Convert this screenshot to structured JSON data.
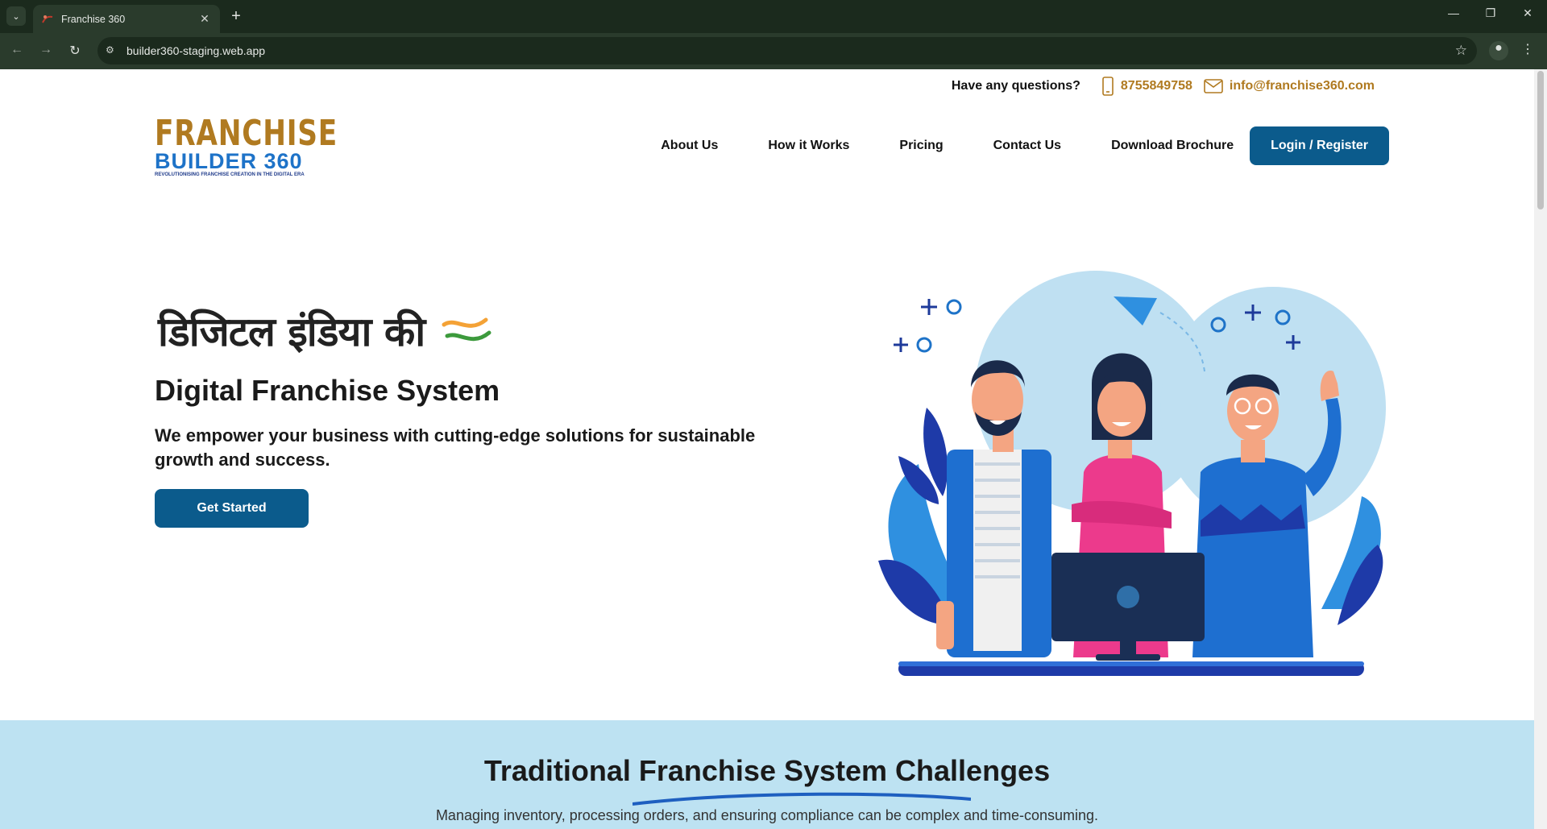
{
  "browser": {
    "tab_title": "Franchise 360",
    "url": "builder360-staging.web.app"
  },
  "topbar": {
    "question": "Have any questions?",
    "phone": "8755849758",
    "email": "info@franchise360.com"
  },
  "logo": {
    "line1": "FRANCHISE",
    "line2": "BUILDER 360",
    "tagline": "REVOLUTIONISING FRANCHISE CREATION IN THE DIGITAL ERA"
  },
  "nav": {
    "items": [
      "About Us",
      "How it Works",
      "Pricing",
      "Contact Us",
      "Download Brochure"
    ],
    "login": "Login / Register"
  },
  "hero": {
    "hindi_title": "डिजिटल इंडिया की",
    "title": "Digital Franchise System",
    "subtitle": "We empower your business with cutting-edge solutions for sustainable growth and success.",
    "cta": "Get Started"
  },
  "challenges": {
    "title": "Traditional Franchise System Challenges",
    "text": "Managing inventory, processing orders, and ensuring compliance can be complex and time-consuming."
  },
  "colors": {
    "brand_gold": "#b07a20",
    "brand_blue": "#0b5b8c",
    "section_bg": "#bde2f2"
  }
}
